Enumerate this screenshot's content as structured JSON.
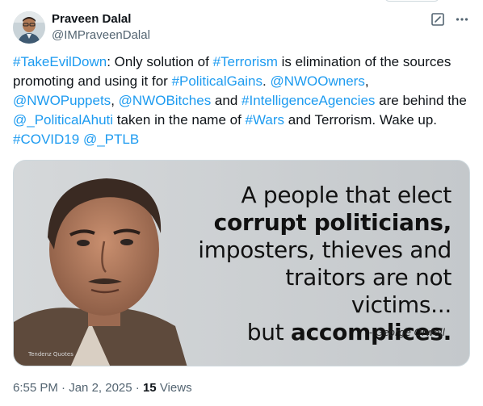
{
  "author": {
    "display_name": "Praveen Dalal",
    "handle": "@IMPraveenDalal"
  },
  "actions": {
    "edit_icon": "edit-icon",
    "more_icon": "more-icon"
  },
  "tweet": {
    "segments": [
      {
        "text": "#TakeEvilDown",
        "link": true
      },
      {
        "text": ": Only solution of ",
        "link": false
      },
      {
        "text": "#Terrorism",
        "link": true
      },
      {
        "text": " is elimination of the sources promoting and using it for ",
        "link": false
      },
      {
        "text": "#PoliticalGains",
        "link": true
      },
      {
        "text": ". ",
        "link": false
      },
      {
        "text": "@NWOOwners",
        "link": true
      },
      {
        "text": ", ",
        "link": false
      },
      {
        "text": "@NWOPuppets",
        "link": true
      },
      {
        "text": ", ",
        "link": false
      },
      {
        "text": "@NWOBitches",
        "link": true
      },
      {
        "text": " and ",
        "link": false
      },
      {
        "text": "#IntelligenceAgencies",
        "link": true
      },
      {
        "text": " are behind the ",
        "link": false
      },
      {
        "text": "@_PoliticalAhuti",
        "link": true
      },
      {
        "text": " taken in the name of ",
        "link": false
      },
      {
        "text": "#Wars",
        "link": true
      },
      {
        "text": " and Terrorism. Wake up. ",
        "link": false
      },
      {
        "text": "#COVID19",
        "link": true
      },
      {
        "text": " ",
        "link": false
      },
      {
        "text": "@_PTLB",
        "link": true
      }
    ]
  },
  "media": {
    "quote_lines": [
      {
        "text": "A people that elect",
        "bold": false
      },
      {
        "text": "corrupt politicians,",
        "bold": true
      },
      {
        "text": "imposters, thieves and",
        "bold": false
      },
      {
        "text": "traitors are not victims...",
        "bold": false
      },
      {
        "text": "but accomplices.",
        "bold": false
      }
    ],
    "quote_bold_word": "accomplices.",
    "attribution": "- George Orwell",
    "watermark": "Tendenz Quotes"
  },
  "meta": {
    "time": "6:55 PM",
    "separator": "·",
    "date": "Jan 2, 2025",
    "views_count": "15",
    "views_label": "Views"
  },
  "colors": {
    "link": "#1d9bf0",
    "text": "#0f1419",
    "secondary": "#536471"
  }
}
